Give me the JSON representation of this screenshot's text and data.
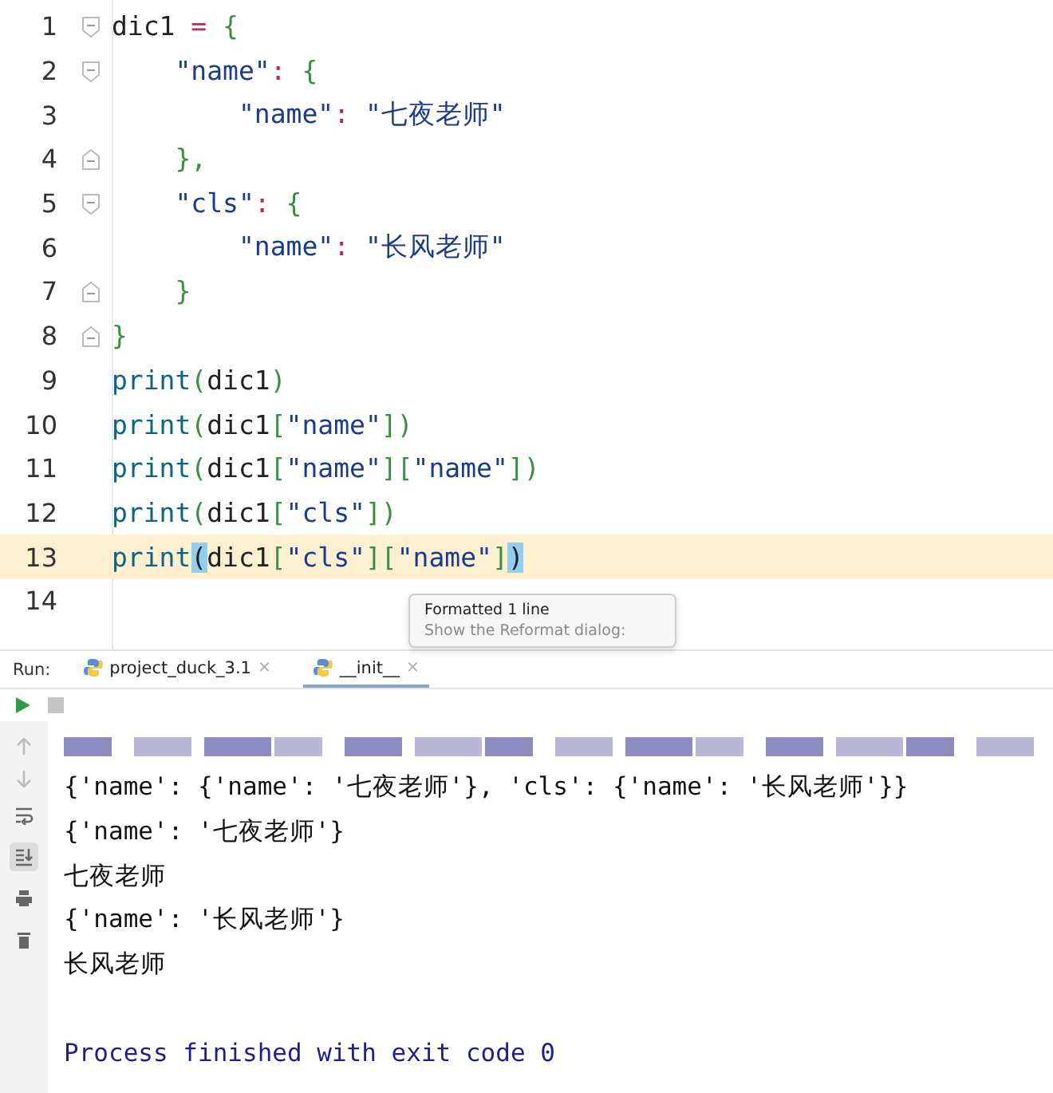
{
  "editor": {
    "lines": [
      {
        "number": "1",
        "kind": "fold-start",
        "current": false,
        "tokens": [
          {
            "kind": "ident",
            "text": "dic1 "
          },
          {
            "kind": "op",
            "text": "="
          },
          {
            "kind": "brace",
            "text": " {"
          }
        ]
      },
      {
        "number": "2",
        "kind": "fold-start",
        "current": false,
        "tokens": [
          {
            "kind": "key",
            "text": "    \"name\""
          },
          {
            "kind": "op",
            "text": ":"
          },
          {
            "kind": "brace",
            "text": " {"
          }
        ]
      },
      {
        "number": "3",
        "kind": "plain",
        "current": false,
        "tokens": [
          {
            "kind": "key",
            "text": "        \"name\""
          },
          {
            "kind": "op",
            "text": ":"
          },
          {
            "kind": "key",
            "text": " \"七夜老师\""
          }
        ]
      },
      {
        "number": "4",
        "kind": "fold-end",
        "current": false,
        "tokens": [
          {
            "kind": "brace",
            "text": "    },"
          }
        ]
      },
      {
        "number": "5",
        "kind": "fold-start",
        "current": false,
        "tokens": [
          {
            "kind": "key",
            "text": "    \"cls\""
          },
          {
            "kind": "op",
            "text": ":"
          },
          {
            "kind": "brace",
            "text": " {"
          }
        ]
      },
      {
        "number": "6",
        "kind": "plain",
        "current": false,
        "tokens": [
          {
            "kind": "key",
            "text": "        \"name\""
          },
          {
            "kind": "op",
            "text": ":"
          },
          {
            "kind": "key",
            "text": " \"长风老师\""
          }
        ]
      },
      {
        "number": "7",
        "kind": "fold-end",
        "current": false,
        "tokens": [
          {
            "kind": "brace",
            "text": "    }"
          }
        ]
      },
      {
        "number": "8",
        "kind": "fold-end",
        "current": false,
        "tokens": [
          {
            "kind": "brace",
            "text": "}"
          }
        ]
      },
      {
        "number": "9",
        "kind": "plain",
        "current": false,
        "tokens": [
          {
            "kind": "builtin",
            "text": "print"
          },
          {
            "kind": "brace",
            "text": "("
          },
          {
            "kind": "ident",
            "text": "dic1"
          },
          {
            "kind": "brace",
            "text": ")"
          }
        ]
      },
      {
        "number": "10",
        "kind": "plain",
        "current": false,
        "tokens": [
          {
            "kind": "builtin",
            "text": "print"
          },
          {
            "kind": "brace",
            "text": "("
          },
          {
            "kind": "ident",
            "text": "dic1"
          },
          {
            "kind": "brace",
            "text": "["
          },
          {
            "kind": "key",
            "text": "\"name\""
          },
          {
            "kind": "brace",
            "text": "])"
          }
        ]
      },
      {
        "number": "11",
        "kind": "plain",
        "current": false,
        "tokens": [
          {
            "kind": "builtin",
            "text": "print"
          },
          {
            "kind": "brace",
            "text": "("
          },
          {
            "kind": "ident",
            "text": "dic1"
          },
          {
            "kind": "brace",
            "text": "["
          },
          {
            "kind": "key",
            "text": "\"name\""
          },
          {
            "kind": "brace",
            "text": "]["
          },
          {
            "kind": "key",
            "text": "\"name\""
          },
          {
            "kind": "brace",
            "text": "])"
          }
        ]
      },
      {
        "number": "12",
        "kind": "plain",
        "current": false,
        "tokens": [
          {
            "kind": "builtin",
            "text": "print"
          },
          {
            "kind": "brace",
            "text": "("
          },
          {
            "kind": "ident",
            "text": "dic1"
          },
          {
            "kind": "brace",
            "text": "["
          },
          {
            "kind": "key",
            "text": "\"cls\""
          },
          {
            "kind": "brace",
            "text": "])"
          }
        ]
      },
      {
        "number": "13",
        "kind": "plain",
        "current": true,
        "tokens": [
          {
            "kind": "builtin",
            "text": "print"
          },
          {
            "kind": "match",
            "text": "("
          },
          {
            "kind": "ident",
            "text": "dic1"
          },
          {
            "kind": "brace",
            "text": "["
          },
          {
            "kind": "key",
            "text": "\"cls\""
          },
          {
            "kind": "brace",
            "text": "]["
          },
          {
            "kind": "key",
            "text": "\"name\""
          },
          {
            "kind": "brace",
            "text": "]"
          },
          {
            "kind": "match",
            "text": ")"
          }
        ]
      },
      {
        "number": "14",
        "kind": "plain",
        "current": false
      }
    ]
  },
  "tooltip": {
    "title": "Formatted 1 line",
    "link": "Show the Reformat dialog:"
  },
  "run": {
    "label": "Run:",
    "tabs": [
      {
        "label": "project_duck_3.1",
        "close": "×",
        "selected": false
      },
      {
        "label": "__init__",
        "close": "×",
        "selected": true
      }
    ]
  },
  "console": {
    "tools": [
      {
        "kind": "wrap",
        "selected": false
      },
      {
        "kind": "scroll-end",
        "selected": true
      },
      {
        "kind": "print",
        "selected": false
      },
      {
        "kind": "trash",
        "selected": false
      }
    ],
    "output": [
      {
        "kind": "out",
        "text": "{'name': {'name': '七夜老师'}, 'cls': {'name': '长风老师'}}"
      },
      {
        "kind": "out",
        "text": "{'name': '七夜老师'}"
      },
      {
        "kind": "out",
        "text": "七夜老师"
      },
      {
        "kind": "out",
        "text": "{'name': '长风老师'}"
      },
      {
        "kind": "out",
        "text": "长风老师"
      },
      {
        "kind": "system",
        "text": "Process finished with exit code 0"
      }
    ]
  }
}
